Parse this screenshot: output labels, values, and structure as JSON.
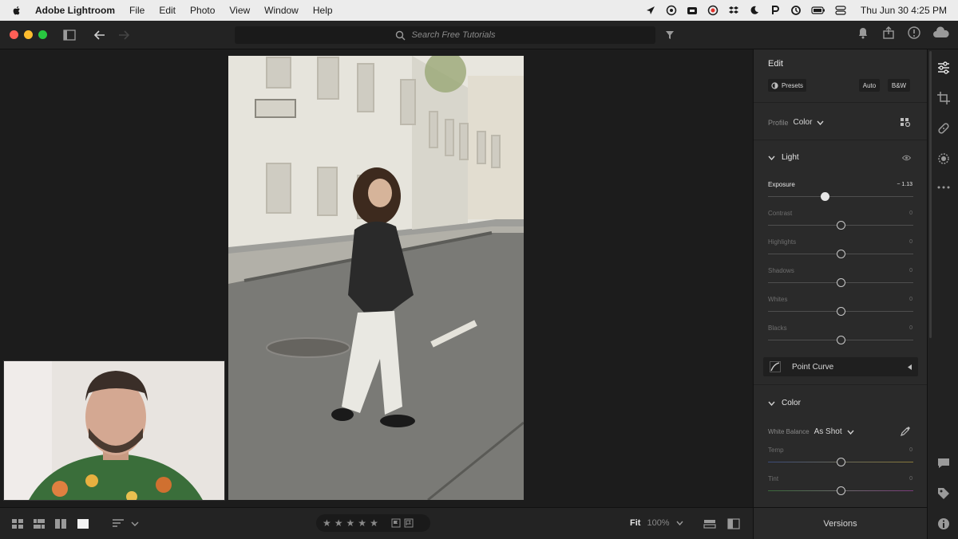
{
  "menubar": {
    "app_name": "Adobe Lightroom",
    "menus": [
      "File",
      "Edit",
      "Photo",
      "View",
      "Window",
      "Help"
    ],
    "clock": "Thu Jun 30  4:25 PM"
  },
  "toolbar": {
    "search_placeholder": "Search Free Tutorials"
  },
  "panel": {
    "title": "Edit",
    "presets_label": "Presets",
    "auto_label": "Auto",
    "bw_label": "B&W",
    "profile_label": "Profile",
    "profile_value": "Color",
    "light_section": "Light",
    "sliders": [
      {
        "label": "Exposure",
        "value": "− 1.13",
        "active": true
      },
      {
        "label": "Contrast",
        "value": "0",
        "active": false
      },
      {
        "label": "Highlights",
        "value": "0",
        "active": false
      },
      {
        "label": "Shadows",
        "value": "0",
        "active": false
      },
      {
        "label": "Whites",
        "value": "0",
        "active": false
      },
      {
        "label": "Blacks",
        "value": "0",
        "active": false
      }
    ],
    "point_curve_label": "Point Curve",
    "color_section": "Color",
    "wb_label": "White Balance",
    "wb_value": "As Shot",
    "color_sliders": [
      {
        "label": "Temp",
        "value": "0"
      },
      {
        "label": "Tint",
        "value": "0"
      }
    ]
  },
  "bottombar": {
    "fit_label": "Fit",
    "zoom_label": "100%",
    "versions_label": "Versions",
    "rating_stars": 5
  },
  "colors": {
    "traffic_red": "#ff5f57",
    "traffic_yellow": "#febc2e",
    "traffic_green": "#28c840",
    "panel_bg": "#2a2a2a"
  }
}
